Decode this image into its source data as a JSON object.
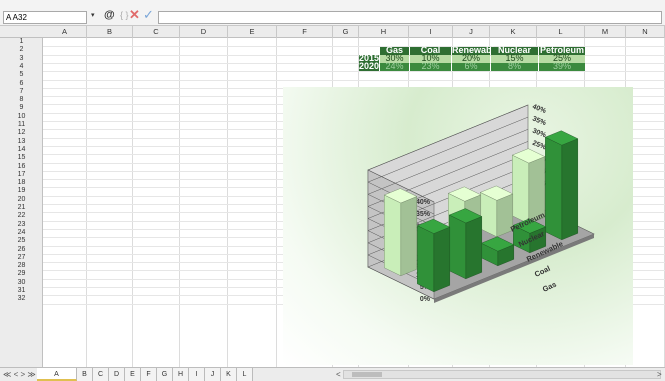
{
  "formula_bar": {
    "name_box": "A A32",
    "at_symbol": "@",
    "brace": "{ }",
    "cancel": "✕",
    "confirm": "✓",
    "formula": ""
  },
  "columns": [
    "A",
    "B",
    "C",
    "D",
    "E",
    "F",
    "G",
    "H",
    "I",
    "J",
    "K",
    "L",
    "M",
    "N",
    "O"
  ],
  "rows": [
    "1",
    "2",
    "3",
    "4",
    "5",
    "6",
    "7",
    "8",
    "9",
    "10",
    "11",
    "12",
    "13",
    "14",
    "15",
    "16",
    "17",
    "18",
    "19",
    "20",
    "21",
    "22",
    "23",
    "24",
    "25",
    "26",
    "27",
    "28",
    "29",
    "30",
    "31",
    "32"
  ],
  "table": {
    "headers": [
      "Gas",
      "Coal",
      "Renewable",
      "Nuclear",
      "Petroleum"
    ],
    "rows": [
      {
        "year": "2015",
        "values": [
          "30%",
          "10%",
          "20%",
          "15%",
          "25%"
        ]
      },
      {
        "year": "2020",
        "values": [
          "24%",
          "23%",
          "6%",
          "8%",
          "39%"
        ]
      }
    ]
  },
  "chart_data": {
    "type": "bar",
    "categories": [
      "Gas",
      "Coal",
      "Renewable",
      "Nuclear",
      "Petroleum"
    ],
    "series": [
      {
        "name": "2015",
        "values": [
          30,
          10,
          20,
          15,
          25
        ]
      },
      {
        "name": "2020",
        "values": [
          24,
          23,
          6,
          8,
          39
        ]
      }
    ],
    "yticks": [
      "0%",
      "5%",
      "10%",
      "15%",
      "20%",
      "25%",
      "30%",
      "35%",
      "40%"
    ],
    "ylim": [
      0,
      40
    ],
    "colors": {
      "s2015": "#bfe3b0",
      "s2020": "#2e8a36"
    },
    "grid": true
  },
  "sheets": {
    "nav_left": "≪ < > ≫",
    "tabs": [
      "A",
      "B",
      "C",
      "D",
      "E",
      "F",
      "G",
      "H",
      "I",
      "J",
      "K",
      "L"
    ],
    "active": "A",
    "scroll_left": "<",
    "scroll_right": ">"
  }
}
